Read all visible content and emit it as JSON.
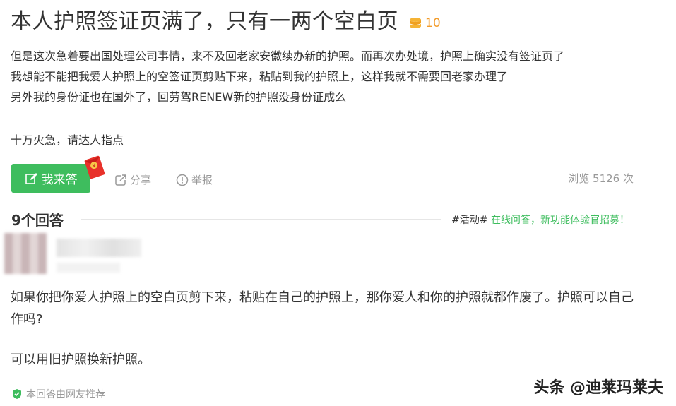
{
  "question": {
    "title": "本人护照签证页满了，只有一两个空白页",
    "reward": "10",
    "lines": [
      "但是这次急着要出国处理公司事情，来不及回老家安徽续办新的护照。而再次办处境，护照上确实没有签证页了",
      "我想能不能把我爱人护照上的空签证页剪贴下来，粘贴到我的护照上，这样我就不需要回老家办理了",
      "另外我的身份证也在国外了，回劳驾RENEW新的护照没身份证成么"
    ],
    "extra": "十万火急，请达人指点"
  },
  "actions": {
    "answer": "我来答",
    "share": "分享",
    "report": "举报",
    "views": "浏览 5126 次"
  },
  "answers_header": {
    "count": "9个回答",
    "activity_tag": "#活动#",
    "activity_text": " 在线问答，新功能体验官招募！"
  },
  "answer": {
    "p1": "如果你把你爱人护照上的空白页剪下来，粘贴在自己的护照上，那你爱人和你的护照就都作废了。护照可以自己作吗?",
    "p2": "可以用旧护照换新护照。",
    "recommend": "本回答由网友推荐"
  },
  "watermark": "头条 @迪莱玛莱夫",
  "colors": {
    "accent": "#3ebd5e",
    "reward": "#f39c2b",
    "muted": "#999999"
  }
}
